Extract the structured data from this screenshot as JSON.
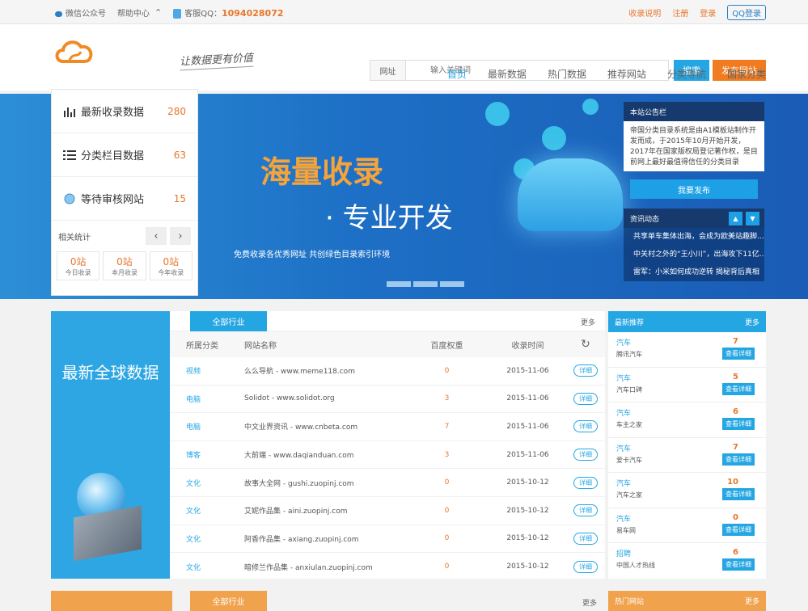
{
  "topbar": {
    "wechat": "微信公众号",
    "help": "帮助中心",
    "qq_label": "客服QQ：",
    "qq_number": "1094028072",
    "links": [
      "收录说明",
      "注册",
      "登录"
    ],
    "qq_login": "QQ登录"
  },
  "header": {
    "slogan": "让数据更有价值",
    "search_label": "网址",
    "search_placeholder": "输入关键词",
    "search_button": "搜索",
    "publish_button": "发布网站",
    "nav": [
      "首页",
      "最新数据",
      "热门数据",
      "推荐网站",
      "分类导航",
      "国家分类"
    ]
  },
  "leftpanel": {
    "rows": [
      {
        "label": "最新收录数据",
        "num": "280"
      },
      {
        "label": "分类栏目数据",
        "num": "63"
      },
      {
        "label": "等待审核网站",
        "num": "15"
      }
    ],
    "stat_title": "相关统计",
    "counts": [
      {
        "value": "0站",
        "label": "今日收录"
      },
      {
        "value": "0站",
        "label": "本月收录"
      },
      {
        "value": "0站",
        "label": "今年收录"
      }
    ]
  },
  "banner": {
    "title1": "海量收录",
    "title2": "· 专业开发",
    "tagline": "免费收录各优秀网址   共创绿色目录索引环境"
  },
  "notice": {
    "title": "本站公告栏",
    "text": "帝国分类目录系统是由A1模板站制作开发而成，于2015年10月开始开发，2017年在国家版权局登记著作权，是目前网上最好最值得信任的分类目录",
    "publish": "我要发布",
    "news_title": "资讯动态",
    "news": [
      "共享单车集体出海，会成为欧美站趣脚...",
      "中关村之外的“王小川”，出海攻下11亿...",
      "雷军：小米如何成功逆转 揭秘背后真相"
    ]
  },
  "section1": {
    "left_title": "最新全球数据",
    "tab": "全部行业",
    "more": "更多",
    "headers": [
      "所属分类",
      "网站名称",
      "百度权重",
      "收录时间"
    ],
    "detail_label": "详细",
    "rows": [
      {
        "cat": "视频",
        "name": "么么导航 - www.meme118.com",
        "weight": "0",
        "date": "2015-11-06"
      },
      {
        "cat": "电脑",
        "name": "Solidot - www.solidot.org",
        "weight": "3",
        "date": "2015-11-06"
      },
      {
        "cat": "电脑",
        "name": "中文业界资讯 - www.cnbeta.com",
        "weight": "7",
        "date": "2015-11-06"
      },
      {
        "cat": "博客",
        "name": "大前端 - www.daqianduan.com",
        "weight": "3",
        "date": "2015-11-06"
      },
      {
        "cat": "文化",
        "name": "故事大全网 - gushi.zuopinj.com",
        "weight": "0",
        "date": "2015-10-12"
      },
      {
        "cat": "文化",
        "name": "艾妮作品集 - aini.zuopinj.com",
        "weight": "0",
        "date": "2015-10-12"
      },
      {
        "cat": "文化",
        "name": "阿香作品集 - axiang.zuopinj.com",
        "weight": "0",
        "date": "2015-10-12"
      },
      {
        "cat": "文化",
        "name": "暗修兰作品集 - anxiulan.zuopinj.com",
        "weight": "0",
        "date": "2015-10-12"
      }
    ],
    "right_title": "最新推荐",
    "right_more": "更多",
    "view_label": "查看详细",
    "recommend": [
      {
        "cat": "汽车",
        "name": "腾讯汽车",
        "count": "7"
      },
      {
        "cat": "汽车",
        "name": "汽车口碑",
        "count": "5"
      },
      {
        "cat": "汽车",
        "name": "车主之家",
        "count": "6"
      },
      {
        "cat": "汽车",
        "name": "爱卡汽车",
        "count": "7"
      },
      {
        "cat": "汽车",
        "name": "汽车之家",
        "count": "10"
      },
      {
        "cat": "汽车",
        "name": "易车网",
        "count": "0"
      },
      {
        "cat": "招聘",
        "name": "中国人才热线",
        "count": "6"
      }
    ]
  },
  "section2": {
    "tab": "全部行业",
    "more": "更多",
    "right_title": "热门网站",
    "right_more": "更多"
  }
}
